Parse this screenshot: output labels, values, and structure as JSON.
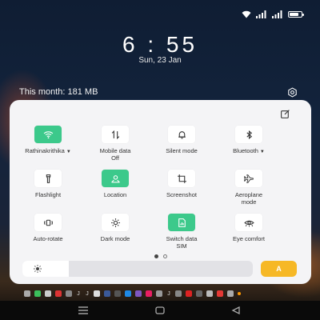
{
  "status_bar": {
    "icons": [
      "wifi-icon",
      "signal-icon-1",
      "signal-icon-2",
      "battery-icon"
    ],
    "battery_level": 0.8
  },
  "lock": {
    "time": "6 : 55",
    "date": "Sun, 23 Jan"
  },
  "data_usage": {
    "text": "This month: 181 MB"
  },
  "quick_settings": {
    "tiles": [
      {
        "label": "Rathinakrithika",
        "has_caret": true,
        "on": true,
        "icon": "wifi-icon"
      },
      {
        "label": "Mobile data\nOff",
        "has_caret": false,
        "on": false,
        "icon": "mobile-data-icon"
      },
      {
        "label": "Silent mode",
        "has_caret": false,
        "on": false,
        "icon": "bell-icon"
      },
      {
        "label": "Bluetooth",
        "has_caret": true,
        "on": false,
        "icon": "bluetooth-icon"
      },
      {
        "label": "Flashlight",
        "has_caret": false,
        "on": false,
        "icon": "flashlight-icon"
      },
      {
        "label": "Location",
        "has_caret": false,
        "on": true,
        "icon": "location-icon"
      },
      {
        "label": "Screenshot",
        "has_caret": false,
        "on": false,
        "icon": "screenshot-icon"
      },
      {
        "label": "Aeroplane\nmode",
        "has_caret": false,
        "on": false,
        "icon": "airplane-icon"
      },
      {
        "label": "Auto-rotate",
        "has_caret": false,
        "on": false,
        "icon": "rotate-icon"
      },
      {
        "label": "Dark mode",
        "has_caret": false,
        "on": false,
        "icon": "dark-mode-icon"
      },
      {
        "label": "Switch data\nSIM",
        "has_caret": false,
        "on": true,
        "icon": "sim-icon"
      },
      {
        "label": "Eye comfort",
        "has_caret": false,
        "on": false,
        "icon": "eye-icon"
      }
    ],
    "page_dots": {
      "count": 2,
      "active": 0
    },
    "brightness": {
      "level": 0.2,
      "auto_label": "A"
    }
  },
  "notification_apps": [
    "J",
    "J",
    "J"
  ],
  "colors": {
    "tile_active": "#3cc98b",
    "auto_brightness": "#f6b826",
    "panel_bg": "#f4f4f6"
  }
}
